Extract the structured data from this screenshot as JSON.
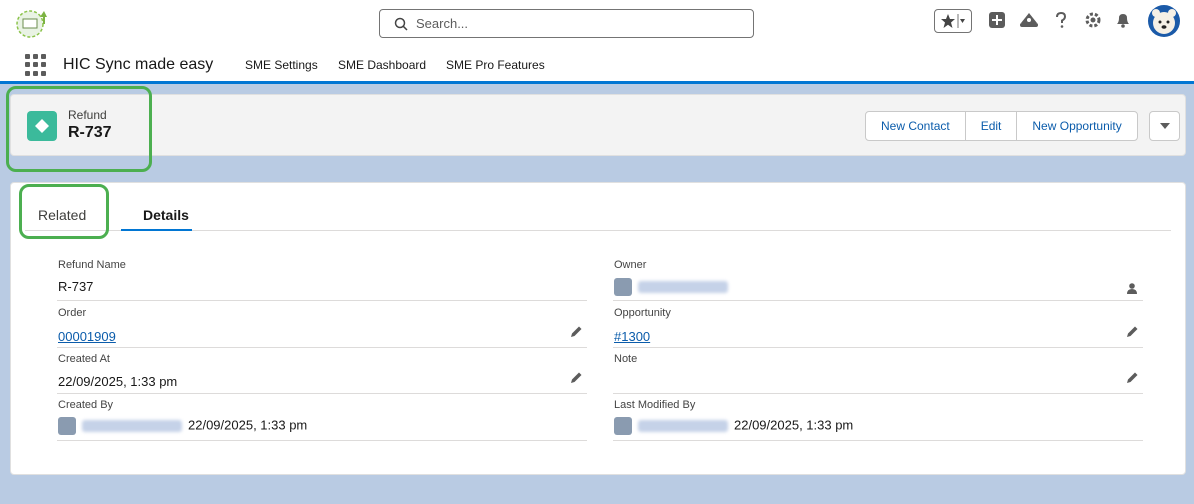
{
  "header": {
    "search_placeholder": "Search..."
  },
  "nav": {
    "app_name": "HIC Sync made easy",
    "items": [
      "SME Settings",
      "SME Dashboard",
      "SME Pro Features"
    ]
  },
  "record": {
    "type": "Refund",
    "name": "R-737",
    "actions": [
      "New Contact",
      "Edit",
      "New Opportunity"
    ]
  },
  "tabs": {
    "related": "Related",
    "details": "Details"
  },
  "fields": {
    "refund_name": {
      "label": "Refund Name",
      "value": "R-737"
    },
    "owner": {
      "label": "Owner"
    },
    "order": {
      "label": "Order",
      "value": "00001909"
    },
    "opportunity": {
      "label": "Opportunity",
      "value": "#1300"
    },
    "created_at": {
      "label": "Created At",
      "value": "22/09/2025, 1:33 pm"
    },
    "note": {
      "label": "Note",
      "value": ""
    },
    "created_by": {
      "label": "Created By",
      "value": "22/09/2025, 1:33 pm"
    },
    "last_modified_by": {
      "label": "Last Modified By",
      "value": "22/09/2025, 1:33 pm"
    }
  },
  "colors": {
    "accent": "#0176d3",
    "record_icon": "#3bba9b",
    "highlight": "#4caf50",
    "background": "#b9cbe3"
  }
}
